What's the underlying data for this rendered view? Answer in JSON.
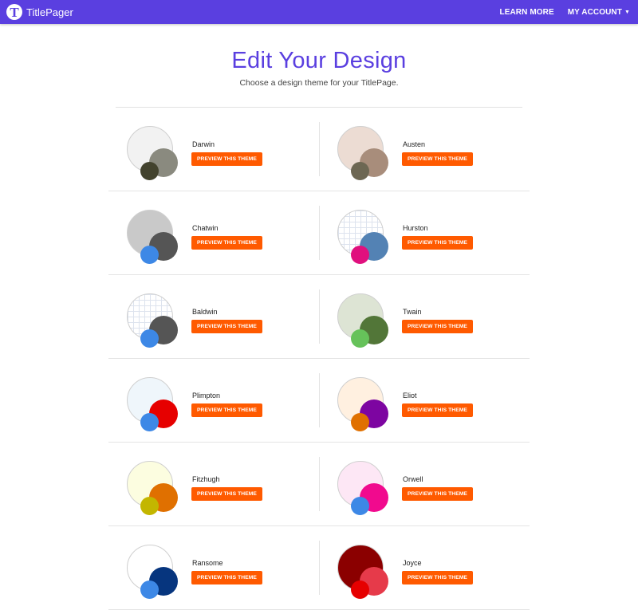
{
  "navbar": {
    "brand_initial": "T",
    "brand_name": "TitlePager",
    "learn_more": "LEARN MORE",
    "my_account": "MY ACCOUNT",
    "color": "#5a3fe0"
  },
  "header": {
    "title": "Edit Your Design",
    "subtitle": "Choose a design theme for your TitlePage."
  },
  "button_label": "PREVIEW THIS THEME",
  "button_color": "#ff5a00",
  "themes": [
    {
      "name": "Darwin",
      "big": "#f2f2f2",
      "mid": "#8a8a7f",
      "small": "#43432e",
      "pattern": "none"
    },
    {
      "name": "Austen",
      "big": "#ecdcd3",
      "mid": "#a88d7b",
      "small": "#6d6753",
      "pattern": "none"
    },
    {
      "name": "Chatwin",
      "big": "#c9c9c9",
      "mid": "#555555",
      "small": "#3d88e6",
      "pattern": "none"
    },
    {
      "name": "Hurston",
      "big": "#ffffff",
      "mid": "#5382b4",
      "small": "#e0107e",
      "pattern": "grid"
    },
    {
      "name": "Baldwin",
      "big": "#ffffff",
      "mid": "#555555",
      "small": "#3d88e6",
      "pattern": "grid"
    },
    {
      "name": "Twain",
      "big": "#dde4d4",
      "mid": "#527638",
      "small": "#66c25a",
      "pattern": "none"
    },
    {
      "name": "Plimpton",
      "big": "#eff6fb",
      "mid": "#e60000",
      "small": "#3d88e6",
      "pattern": "none"
    },
    {
      "name": "Eliot",
      "big": "#fff0e0",
      "mid": "#7d05a1",
      "small": "#e07000",
      "pattern": "none"
    },
    {
      "name": "Fitzhugh",
      "big": "#fcfde0",
      "mid": "#e07000",
      "small": "#c3b600",
      "pattern": "none"
    },
    {
      "name": "Orwell",
      "big": "#fde7f5",
      "mid": "#f10a8e",
      "small": "#3d88e6",
      "pattern": "none"
    },
    {
      "name": "Ransome",
      "big": "#ffffff",
      "mid": "#06357e",
      "small": "#3d88e6",
      "pattern": "none"
    },
    {
      "name": "Joyce",
      "big": "#8b0000",
      "mid": "#e63a4a",
      "small": "#e60000",
      "pattern": "none"
    }
  ]
}
